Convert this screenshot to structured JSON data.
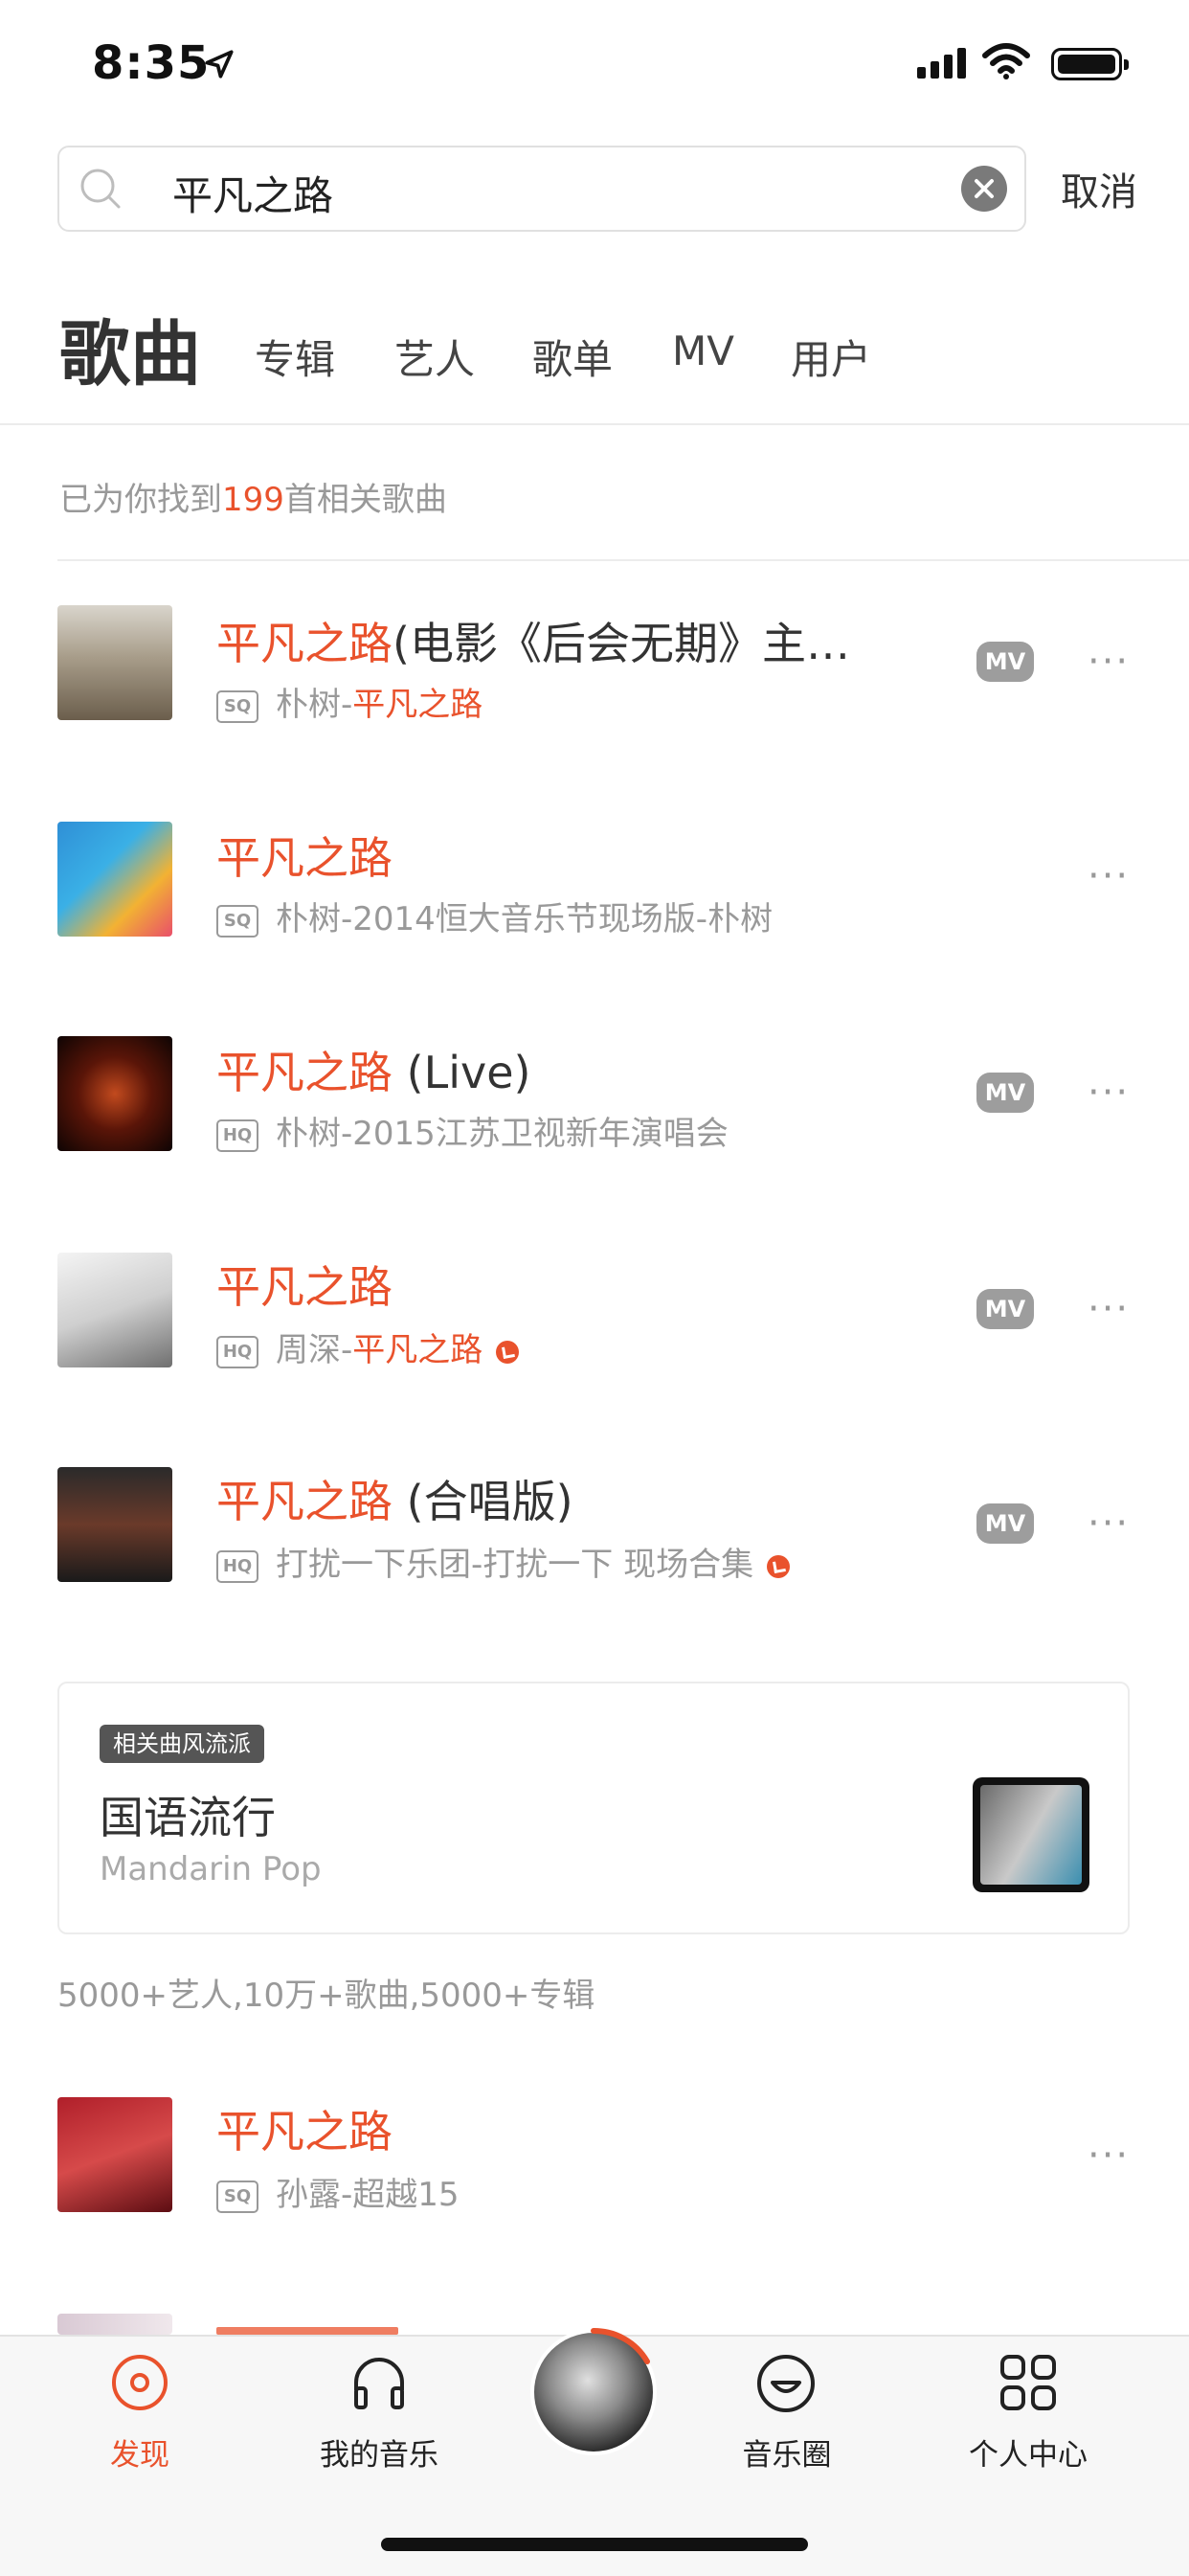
{
  "status_bar": {
    "time": "8:35"
  },
  "search": {
    "value": "平凡之路",
    "cancel_label": "取消"
  },
  "tabs": {
    "active": "歌曲",
    "others": [
      "专辑",
      "艺人",
      "歌单",
      "MV",
      "用户"
    ]
  },
  "result": {
    "prefix": "已为你找到",
    "count": "199",
    "suffix": "首相关歌曲"
  },
  "songs": [
    {
      "title_hl": "平凡之路",
      "title_rest": "(电影《后会无期》主…",
      "quality": "SQ",
      "sub_plain": "朴树-",
      "sub_hl": "平凡之路",
      "sub_rest": "",
      "has_mv": true,
      "mv_label": "MV",
      "more_label": "···"
    },
    {
      "title_hl": "平凡之路",
      "title_rest": "",
      "quality": "SQ",
      "sub_plain": "朴树-2014恒大音乐节现场版-朴树",
      "sub_hl": "",
      "sub_rest": "",
      "has_mv": false,
      "mv_label": "",
      "more_label": "···"
    },
    {
      "title_hl": "平凡之路",
      "title_rest": " (Live)",
      "quality": "HQ",
      "sub_plain": "朴树-2015江苏卫视新年演唱会",
      "sub_hl": "",
      "sub_rest": "",
      "has_mv": true,
      "mv_label": "MV",
      "more_label": "···"
    },
    {
      "title_hl": "平凡之路",
      "title_rest": "",
      "quality": "HQ",
      "sub_plain": "周深-",
      "sub_hl": "平凡之路",
      "sub_rest": "",
      "has_mv": true,
      "mv_label": "MV",
      "more_label": "···"
    },
    {
      "title_hl": "平凡之路",
      "title_rest": " (合唱版)",
      "quality": "HQ",
      "sub_plain": "打扰一下乐团-打扰一下 现场合集",
      "sub_hl": "",
      "sub_rest": "",
      "has_mv": true,
      "mv_label": "MV",
      "more_label": "···"
    },
    {
      "title_hl": "平凡之路",
      "title_rest": "",
      "quality": "SQ",
      "sub_plain": "孙露-超越15",
      "sub_hl": "",
      "sub_rest": "",
      "has_mv": false,
      "mv_label": "",
      "more_label": "···"
    }
  ],
  "genre": {
    "tag": "相关曲风流派",
    "name": "国语流行",
    "name_en": "Mandarin Pop",
    "stats": "5000+艺人,10万+歌曲,5000+专辑"
  },
  "nav": {
    "discover": "发现",
    "my_music": "我的音乐",
    "circle": "音乐圈",
    "profile": "个人中心"
  },
  "colors": {
    "accent": "#e9522c",
    "muted": "#999999",
    "badge": "#9d9d9d"
  },
  "icons": [
    "location-arrow-icon",
    "cellular-signal-icon",
    "wifi-icon",
    "battery-icon",
    "search-icon",
    "clear-icon",
    "pick-badge-icon",
    "discover-icon",
    "headphones-icon",
    "smile-icon",
    "grid-icon"
  ]
}
